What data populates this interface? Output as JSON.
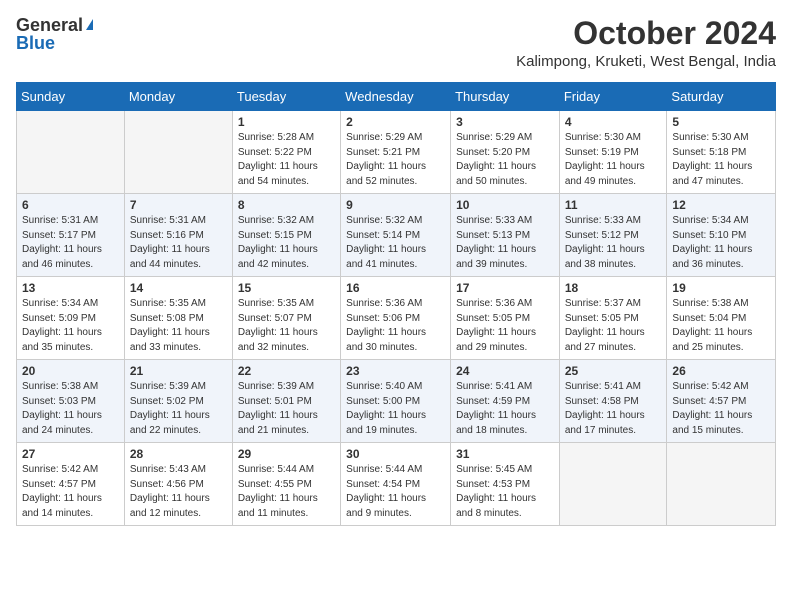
{
  "header": {
    "logo_general": "General",
    "logo_blue": "Blue",
    "month": "October 2024",
    "location": "Kalimpong, Kruketi, West Bengal, India"
  },
  "days_of_week": [
    "Sunday",
    "Monday",
    "Tuesday",
    "Wednesday",
    "Thursday",
    "Friday",
    "Saturday"
  ],
  "weeks": [
    [
      {
        "day": "",
        "sunrise": "",
        "sunset": "",
        "daylight": ""
      },
      {
        "day": "",
        "sunrise": "",
        "sunset": "",
        "daylight": ""
      },
      {
        "day": "1",
        "sunrise": "Sunrise: 5:28 AM",
        "sunset": "Sunset: 5:22 PM",
        "daylight": "Daylight: 11 hours and 54 minutes."
      },
      {
        "day": "2",
        "sunrise": "Sunrise: 5:29 AM",
        "sunset": "Sunset: 5:21 PM",
        "daylight": "Daylight: 11 hours and 52 minutes."
      },
      {
        "day": "3",
        "sunrise": "Sunrise: 5:29 AM",
        "sunset": "Sunset: 5:20 PM",
        "daylight": "Daylight: 11 hours and 50 minutes."
      },
      {
        "day": "4",
        "sunrise": "Sunrise: 5:30 AM",
        "sunset": "Sunset: 5:19 PM",
        "daylight": "Daylight: 11 hours and 49 minutes."
      },
      {
        "day": "5",
        "sunrise": "Sunrise: 5:30 AM",
        "sunset": "Sunset: 5:18 PM",
        "daylight": "Daylight: 11 hours and 47 minutes."
      }
    ],
    [
      {
        "day": "6",
        "sunrise": "Sunrise: 5:31 AM",
        "sunset": "Sunset: 5:17 PM",
        "daylight": "Daylight: 11 hours and 46 minutes."
      },
      {
        "day": "7",
        "sunrise": "Sunrise: 5:31 AM",
        "sunset": "Sunset: 5:16 PM",
        "daylight": "Daylight: 11 hours and 44 minutes."
      },
      {
        "day": "8",
        "sunrise": "Sunrise: 5:32 AM",
        "sunset": "Sunset: 5:15 PM",
        "daylight": "Daylight: 11 hours and 42 minutes."
      },
      {
        "day": "9",
        "sunrise": "Sunrise: 5:32 AM",
        "sunset": "Sunset: 5:14 PM",
        "daylight": "Daylight: 11 hours and 41 minutes."
      },
      {
        "day": "10",
        "sunrise": "Sunrise: 5:33 AM",
        "sunset": "Sunset: 5:13 PM",
        "daylight": "Daylight: 11 hours and 39 minutes."
      },
      {
        "day": "11",
        "sunrise": "Sunrise: 5:33 AM",
        "sunset": "Sunset: 5:12 PM",
        "daylight": "Daylight: 11 hours and 38 minutes."
      },
      {
        "day": "12",
        "sunrise": "Sunrise: 5:34 AM",
        "sunset": "Sunset: 5:10 PM",
        "daylight": "Daylight: 11 hours and 36 minutes."
      }
    ],
    [
      {
        "day": "13",
        "sunrise": "Sunrise: 5:34 AM",
        "sunset": "Sunset: 5:09 PM",
        "daylight": "Daylight: 11 hours and 35 minutes."
      },
      {
        "day": "14",
        "sunrise": "Sunrise: 5:35 AM",
        "sunset": "Sunset: 5:08 PM",
        "daylight": "Daylight: 11 hours and 33 minutes."
      },
      {
        "day": "15",
        "sunrise": "Sunrise: 5:35 AM",
        "sunset": "Sunset: 5:07 PM",
        "daylight": "Daylight: 11 hours and 32 minutes."
      },
      {
        "day": "16",
        "sunrise": "Sunrise: 5:36 AM",
        "sunset": "Sunset: 5:06 PM",
        "daylight": "Daylight: 11 hours and 30 minutes."
      },
      {
        "day": "17",
        "sunrise": "Sunrise: 5:36 AM",
        "sunset": "Sunset: 5:05 PM",
        "daylight": "Daylight: 11 hours and 29 minutes."
      },
      {
        "day": "18",
        "sunrise": "Sunrise: 5:37 AM",
        "sunset": "Sunset: 5:05 PM",
        "daylight": "Daylight: 11 hours and 27 minutes."
      },
      {
        "day": "19",
        "sunrise": "Sunrise: 5:38 AM",
        "sunset": "Sunset: 5:04 PM",
        "daylight": "Daylight: 11 hours and 25 minutes."
      }
    ],
    [
      {
        "day": "20",
        "sunrise": "Sunrise: 5:38 AM",
        "sunset": "Sunset: 5:03 PM",
        "daylight": "Daylight: 11 hours and 24 minutes."
      },
      {
        "day": "21",
        "sunrise": "Sunrise: 5:39 AM",
        "sunset": "Sunset: 5:02 PM",
        "daylight": "Daylight: 11 hours and 22 minutes."
      },
      {
        "day": "22",
        "sunrise": "Sunrise: 5:39 AM",
        "sunset": "Sunset: 5:01 PM",
        "daylight": "Daylight: 11 hours and 21 minutes."
      },
      {
        "day": "23",
        "sunrise": "Sunrise: 5:40 AM",
        "sunset": "Sunset: 5:00 PM",
        "daylight": "Daylight: 11 hours and 19 minutes."
      },
      {
        "day": "24",
        "sunrise": "Sunrise: 5:41 AM",
        "sunset": "Sunset: 4:59 PM",
        "daylight": "Daylight: 11 hours and 18 minutes."
      },
      {
        "day": "25",
        "sunrise": "Sunrise: 5:41 AM",
        "sunset": "Sunset: 4:58 PM",
        "daylight": "Daylight: 11 hours and 17 minutes."
      },
      {
        "day": "26",
        "sunrise": "Sunrise: 5:42 AM",
        "sunset": "Sunset: 4:57 PM",
        "daylight": "Daylight: 11 hours and 15 minutes."
      }
    ],
    [
      {
        "day": "27",
        "sunrise": "Sunrise: 5:42 AM",
        "sunset": "Sunset: 4:57 PM",
        "daylight": "Daylight: 11 hours and 14 minutes."
      },
      {
        "day": "28",
        "sunrise": "Sunrise: 5:43 AM",
        "sunset": "Sunset: 4:56 PM",
        "daylight": "Daylight: 11 hours and 12 minutes."
      },
      {
        "day": "29",
        "sunrise": "Sunrise: 5:44 AM",
        "sunset": "Sunset: 4:55 PM",
        "daylight": "Daylight: 11 hours and 11 minutes."
      },
      {
        "day": "30",
        "sunrise": "Sunrise: 5:44 AM",
        "sunset": "Sunset: 4:54 PM",
        "daylight": "Daylight: 11 hours and 9 minutes."
      },
      {
        "day": "31",
        "sunrise": "Sunrise: 5:45 AM",
        "sunset": "Sunset: 4:53 PM",
        "daylight": "Daylight: 11 hours and 8 minutes."
      },
      {
        "day": "",
        "sunrise": "",
        "sunset": "",
        "daylight": ""
      },
      {
        "day": "",
        "sunrise": "",
        "sunset": "",
        "daylight": ""
      }
    ]
  ]
}
